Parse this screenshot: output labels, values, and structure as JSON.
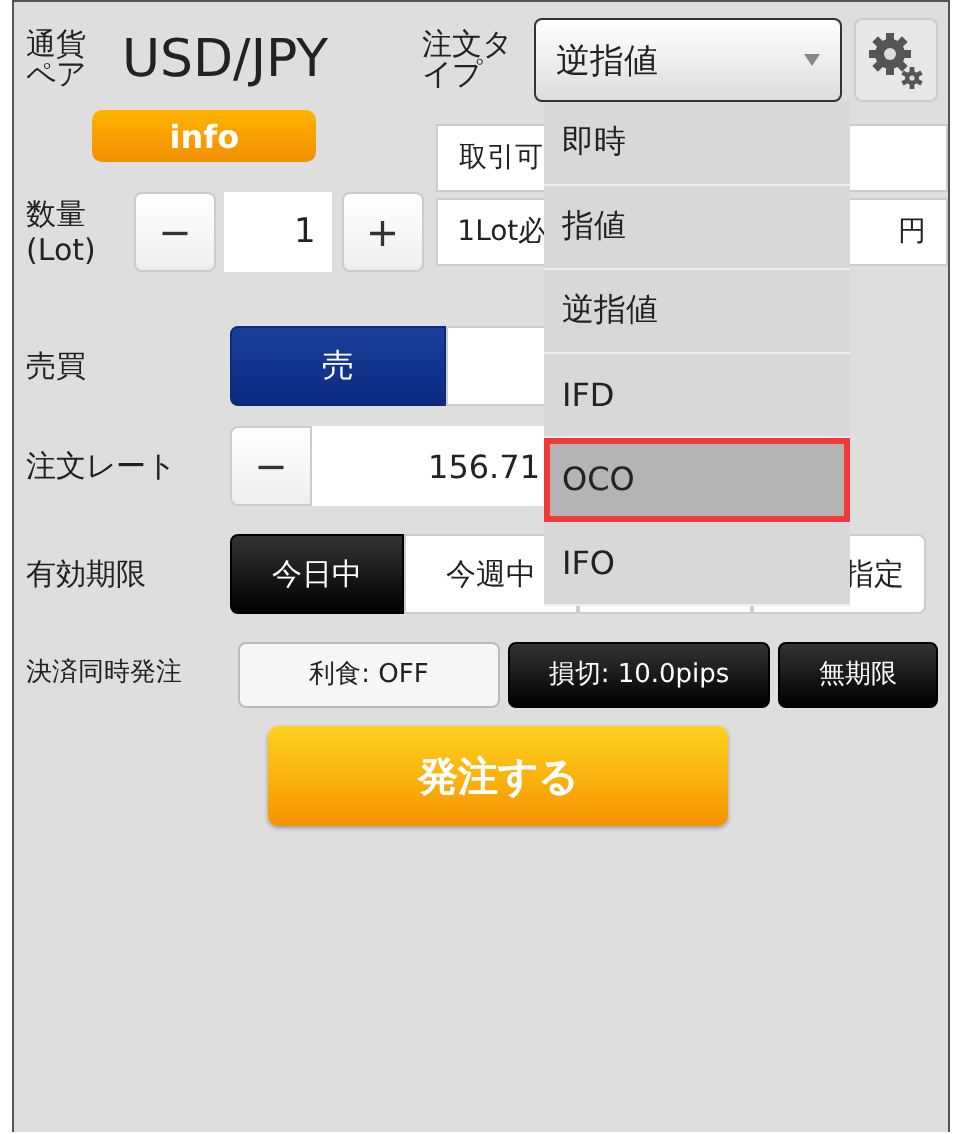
{
  "pair": {
    "label": "通貨ペア",
    "value": "USD/JPY"
  },
  "order_type": {
    "label": "注文タイプ",
    "value": "逆指値",
    "expanded": true
  },
  "info_button": "info",
  "available_field": "取引可",
  "quantity": {
    "label": [
      "数量",
      "(Lot)"
    ],
    "minus": "−",
    "value": "1",
    "plus": "+"
  },
  "margin_field": {
    "left": "1Lot必",
    "right": "円"
  },
  "side": {
    "label": "売買",
    "options": [
      {
        "label": "売",
        "selected": true
      },
      {
        "selected": false
      }
    ]
  },
  "rate": {
    "label": "注文レート",
    "minus": "−",
    "value": "156.71"
  },
  "expiry": {
    "label": "有効期限",
    "options": [
      {
        "label": "今日中",
        "selected": true
      },
      {
        "label": "今週中",
        "selected": false
      },
      {
        "selected": false
      },
      {
        "label": "指定",
        "selected": false
      }
    ]
  },
  "settlement": {
    "label": "決済同時発注",
    "options": [
      {
        "label": "利食: OFF",
        "selected": false
      },
      {
        "label": "損切: 10.0pips",
        "selected": true
      },
      {
        "label": "無期限",
        "selected": true
      }
    ]
  },
  "submit_button": "発注する",
  "dropdown_options": [
    {
      "label": "即時",
      "selected": false
    },
    {
      "label": "指値",
      "selected": false
    },
    {
      "label": "逆指値",
      "selected": false
    },
    {
      "label": "IFD",
      "selected": false
    },
    {
      "label": "OCO",
      "selected": true
    },
    {
      "label": "IFO",
      "selected": false
    }
  ]
}
